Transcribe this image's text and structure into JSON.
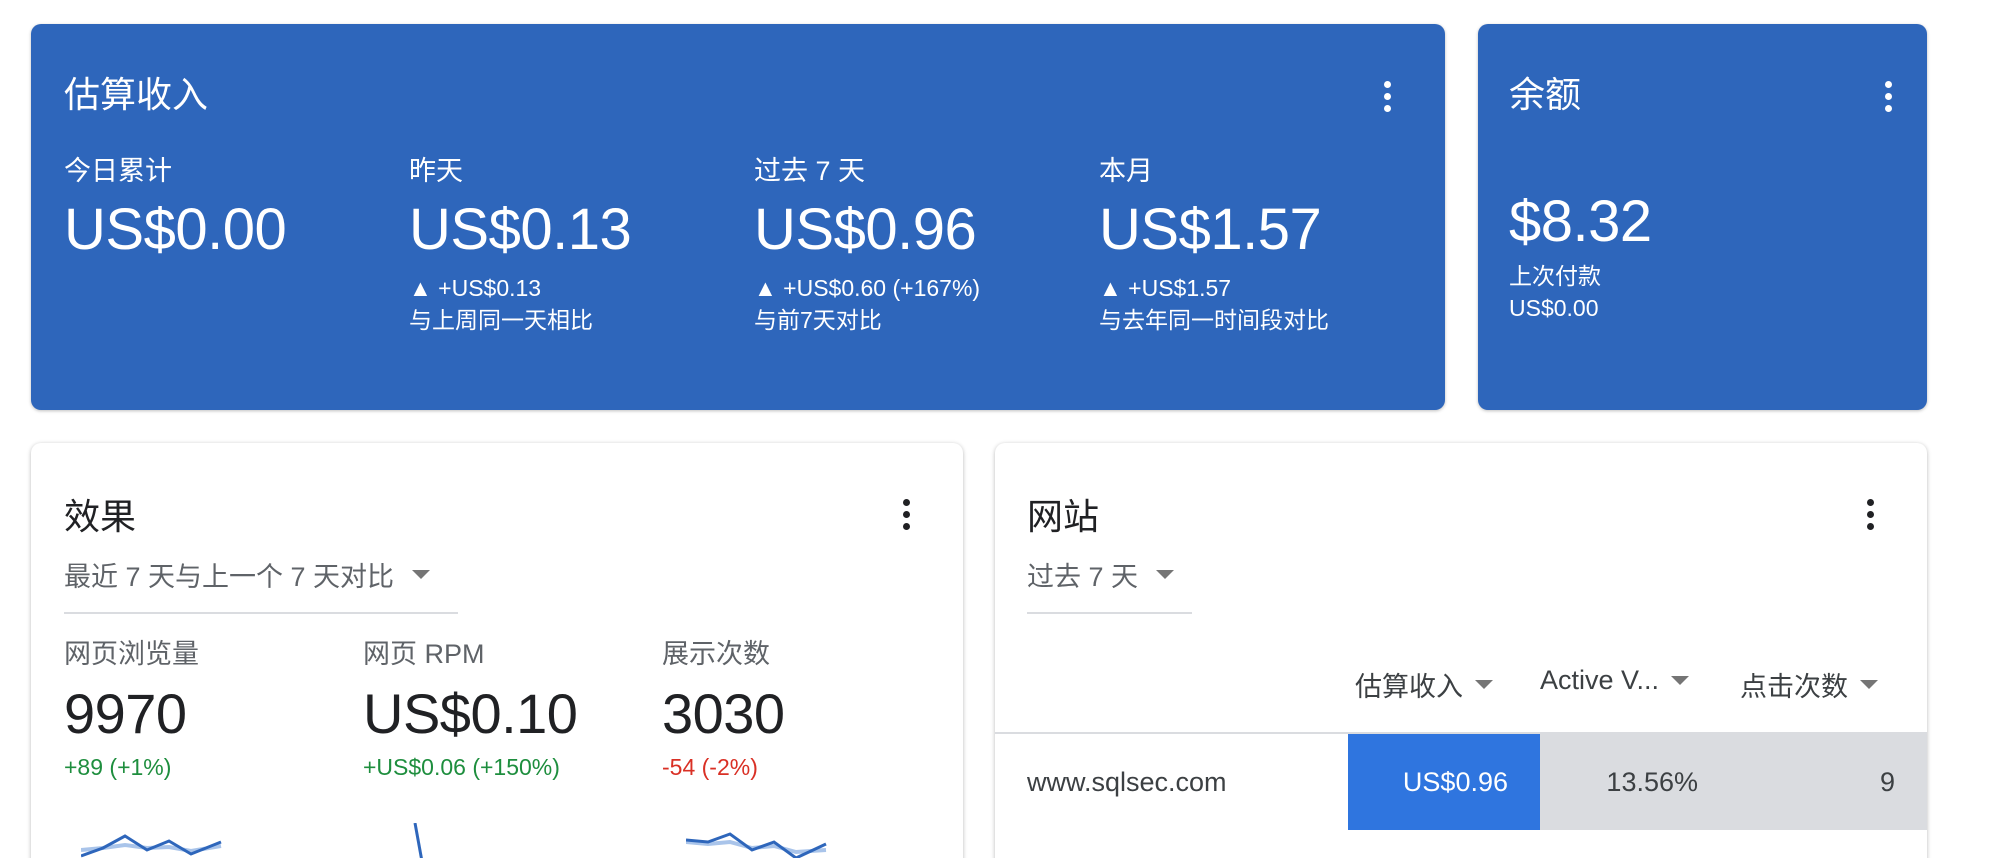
{
  "earnings": {
    "title": "估算收入",
    "metrics": [
      {
        "label": "今日累计",
        "value": "US$0.00",
        "change": "",
        "compare": ""
      },
      {
        "label": "昨天",
        "value": "US$0.13",
        "change": "▲ +US$0.13",
        "compare": "与上周同一天相比"
      },
      {
        "label": "过去 7 天",
        "value": "US$0.96",
        "change": "▲ +US$0.60 (+167%)",
        "compare": "与前7天对比"
      },
      {
        "label": "本月",
        "value": "US$1.57",
        "change": "▲ +US$1.57",
        "compare": "与去年同一时间段对比"
      }
    ]
  },
  "balance": {
    "title": "余额",
    "value": "$8.32",
    "last_payment_label": "上次付款",
    "last_payment_value": "US$0.00"
  },
  "performance": {
    "title": "效果",
    "range": "最近 7 天与上一个 7 天对比",
    "metrics": [
      {
        "label": "网页浏览量",
        "value": "9970",
        "change": "+89 (+1%)",
        "trend": "up"
      },
      {
        "label": "网页 RPM",
        "value": "US$0.10",
        "change": "+US$0.06 (+150%)",
        "trend": "up"
      },
      {
        "label": "展示次数",
        "value": "3030",
        "change": "-54 (-2%)",
        "trend": "down"
      }
    ]
  },
  "sites": {
    "title": "网站",
    "range": "过去 7 天",
    "columns": [
      "估算收入",
      "Active V...",
      "点击次数"
    ],
    "rows": [
      {
        "site": "www.sqlsec.com",
        "earnings": "US$0.96",
        "active": "13.56%",
        "clicks": "9"
      }
    ]
  },
  "colors": {
    "primary_card": "#2e66bb",
    "highlight_cell": "#2f75df",
    "secondary_cell": "#dadce0",
    "positive": "#1e8e3e",
    "negative": "#d93025",
    "spark_primary": "#2e66bb",
    "spark_secondary": "#a9c4ea"
  }
}
